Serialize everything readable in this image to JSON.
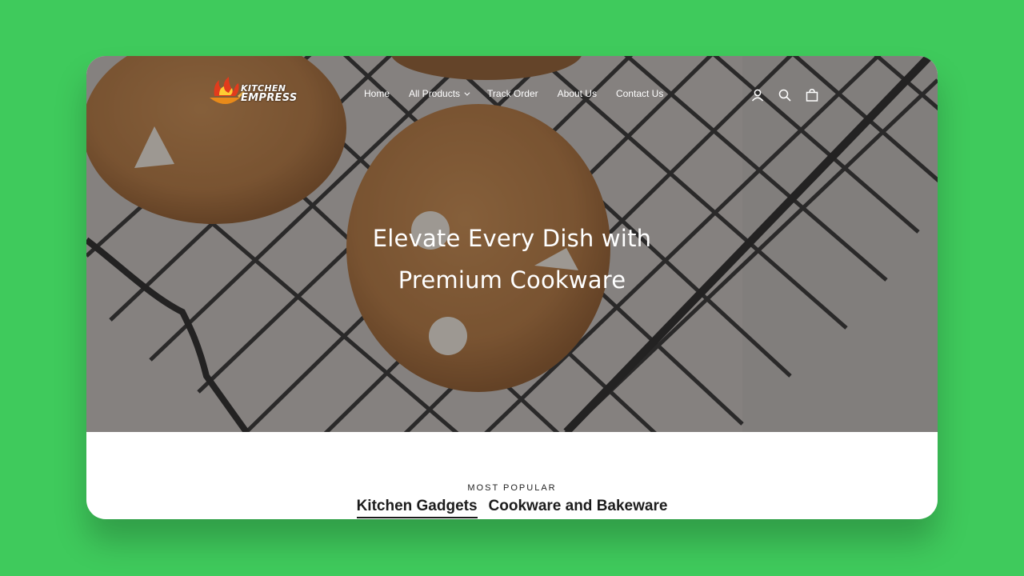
{
  "brand": {
    "logo_line1": "KITCHEN",
    "logo_line2": "EMPRESS"
  },
  "nav": {
    "items": [
      {
        "label": "Home"
      },
      {
        "label": "All Products",
        "has_dropdown": true
      },
      {
        "label": "Track Order"
      },
      {
        "label": "About Us"
      },
      {
        "label": "Contact Us"
      }
    ]
  },
  "header_icons": [
    "account-icon",
    "search-icon",
    "cart-icon"
  ],
  "hero": {
    "title_line1": "Elevate Every Dish with",
    "title_line2": "Premium Cookware"
  },
  "popular": {
    "label": "MOST POPULAR",
    "tabs": [
      {
        "label": "Kitchen Gadgets",
        "active": true
      },
      {
        "label": "Cookware and Bakeware",
        "active": false
      }
    ]
  },
  "colors": {
    "background": "#3fca5c",
    "text_dark": "#1c1c1c",
    "hero_text": "#ffffff"
  }
}
